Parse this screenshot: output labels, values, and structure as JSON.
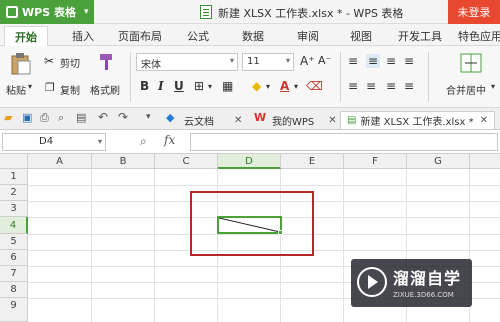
{
  "titlebar": {
    "app_name": "WPS 表格",
    "document_title": "新建 XLSX 工作表.xlsx * - WPS 表格",
    "login": "未登录"
  },
  "menu": {
    "tabs": [
      "开始",
      "插入",
      "页面布局",
      "公式",
      "数据",
      "审阅",
      "视图",
      "开发工具",
      "特色应用"
    ],
    "active": "开始"
  },
  "ribbon": {
    "paste": "粘贴",
    "cut": "剪切",
    "copy": "复制",
    "format_painter": "格式刷",
    "font_name": "宋体",
    "font_size": "11",
    "merge_center": "合并居中"
  },
  "quickbar": {
    "tabs": [
      {
        "label": "云文档",
        "closable": true
      },
      {
        "label": "我的WPS",
        "closable": true
      },
      {
        "label": "新建 XLSX 工作表.xlsx *",
        "closable": true,
        "active": true
      }
    ]
  },
  "formula_bar": {
    "name_box": "D4",
    "fx": "fx",
    "value": ""
  },
  "sheet": {
    "columns": [
      "A",
      "B",
      "C",
      "D",
      "E",
      "F",
      "G"
    ],
    "rows": [
      "1",
      "2",
      "3",
      "4",
      "5",
      "6",
      "7",
      "8",
      "9"
    ],
    "active_cell": "D4",
    "active_cell_content": "diagonal border line"
  },
  "colors": {
    "accent_green": "#4aa13c",
    "login_red": "#e8482f",
    "highlight_red": "#b42828"
  },
  "watermark": {
    "title": "溜溜自学",
    "url": "ZIXUE.3D66.COM"
  }
}
